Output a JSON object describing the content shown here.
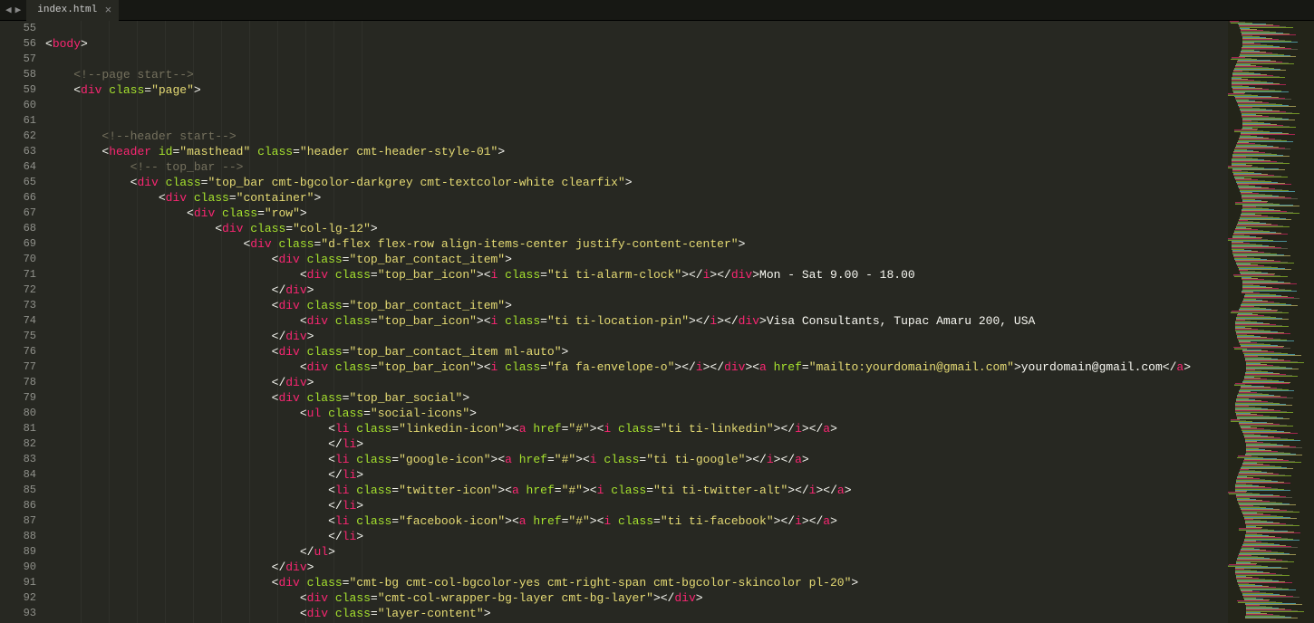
{
  "tab": {
    "title": "index.html",
    "close": "×"
  },
  "nav": {
    "back": "◀",
    "forward": "▶"
  },
  "gutter": [
    "55",
    "56",
    "57",
    "58",
    "59",
    "60",
    "61",
    "62",
    "63",
    "64",
    "65",
    "66",
    "67",
    "68",
    "69",
    "70",
    "71",
    "72",
    "73",
    "74",
    "75",
    "76",
    "77",
    "78",
    "79",
    "80",
    "81",
    "82",
    "83",
    "84",
    "85",
    "86",
    "87",
    "88",
    "89",
    "90",
    "91",
    "92",
    "93"
  ],
  "code": {
    "l55": "",
    "l56_open": "<",
    "l56_tag": "body",
    "l56_close": ">",
    "l57": "",
    "l58_cmt": "<!--page start-->",
    "l59_p1": "<",
    "l59_tag": "div",
    "l59_a1": " class",
    "l59_eq": "=",
    "l59_v1": "\"page\"",
    "l59_p2": ">",
    "l60": "",
    "l61": "",
    "l62_cmt": "<!--header start-->",
    "l63_p1": "<",
    "l63_tag": "header",
    "l63_a1": " id",
    "l63_eq1": "=",
    "l63_v1": "\"masthead\"",
    "l63_a2": " class",
    "l63_eq2": "=",
    "l63_v2": "\"header cmt-header-style-01\"",
    "l63_p2": ">",
    "l64_cmt": "<!-- top_bar -->",
    "l65_p1": "<",
    "l65_tag": "div",
    "l65_a1": " class",
    "l65_eq": "=",
    "l65_v1": "\"top_bar cmt-bgcolor-darkgrey cmt-textcolor-white clearfix\"",
    "l65_p2": ">",
    "l66_p1": "<",
    "l66_tag": "div",
    "l66_a1": " class",
    "l66_eq": "=",
    "l66_v1": "\"container\"",
    "l66_p2": ">",
    "l67_p1": "<",
    "l67_tag": "div",
    "l67_a1": " class",
    "l67_eq": "=",
    "l67_v1": "\"row\"",
    "l67_p2": ">",
    "l68_p1": "<",
    "l68_tag": "div",
    "l68_a1": " class",
    "l68_eq": "=",
    "l68_v1": "\"col-lg-12\"",
    "l68_p2": ">",
    "l69_p1": "<",
    "l69_tag": "div",
    "l69_a1": " class",
    "l69_eq": "=",
    "l69_v1": "\"d-flex flex-row align-items-center justify-content-center\"",
    "l69_p2": ">",
    "l70_p1": "<",
    "l70_tag": "div",
    "l70_a1": " class",
    "l70_eq": "=",
    "l70_v1": "\"top_bar_contact_item\"",
    "l70_p2": ">",
    "l71_p1": "<",
    "l71_tag1": "div",
    "l71_a1": " class",
    "l71_eq1": "=",
    "l71_v1": "\"top_bar_icon\"",
    "l71_p2": "><",
    "l71_tag2": "i",
    "l71_a2": " class",
    "l71_eq2": "=",
    "l71_v2": "\"ti ti-alarm-clock\"",
    "l71_p3": "></",
    "l71_tag3": "i",
    "l71_p4": "></",
    "l71_tag4": "div",
    "l71_p5": ">",
    "l71_txt": "Mon - Sat 9.00 - 18.00",
    "l72_p1": "</",
    "l72_tag": "div",
    "l72_p2": ">",
    "l73_p1": "<",
    "l73_tag": "div",
    "l73_a1": " class",
    "l73_eq": "=",
    "l73_v1": "\"top_bar_contact_item\"",
    "l73_p2": ">",
    "l74_p1": "<",
    "l74_tag1": "div",
    "l74_a1": " class",
    "l74_eq1": "=",
    "l74_v1": "\"top_bar_icon\"",
    "l74_p2": "><",
    "l74_tag2": "i",
    "l74_a2": " class",
    "l74_eq2": "=",
    "l74_v2": "\"ti ti-location-pin\"",
    "l74_p3": "></",
    "l74_tag3": "i",
    "l74_p4": "></",
    "l74_tag4": "div",
    "l74_p5": ">",
    "l74_txt": "Visa Consultants, Tupac Amaru 200, USA",
    "l75_p1": "</",
    "l75_tag": "div",
    "l75_p2": ">",
    "l76_p1": "<",
    "l76_tag": "div",
    "l76_a1": " class",
    "l76_eq": "=",
    "l76_v1": "\"top_bar_contact_item ml-auto\"",
    "l76_p2": ">",
    "l77_p1": "<",
    "l77_tag1": "div",
    "l77_a1": " class",
    "l77_eq1": "=",
    "l77_v1": "\"top_bar_icon\"",
    "l77_p2": "><",
    "l77_tag2": "i",
    "l77_a2": " class",
    "l77_eq2": "=",
    "l77_v2": "\"fa fa-envelope-o\"",
    "l77_p3": "></",
    "l77_tag3": "i",
    "l77_p4": "></",
    "l77_tag4": "div",
    "l77_p5": "><",
    "l77_tag5": "a",
    "l77_a3": " href",
    "l77_eq3": "=",
    "l77_v3": "\"mailto:yourdomain@gmail.com\"",
    "l77_p6": ">",
    "l77_txt": "yourdomain@gmail.com",
    "l77_p7": "</",
    "l77_tag6": "a",
    "l77_p8": ">",
    "l78_p1": "</",
    "l78_tag": "div",
    "l78_p2": ">",
    "l79_p1": "<",
    "l79_tag": "div",
    "l79_a1": " class",
    "l79_eq": "=",
    "l79_v1": "\"top_bar_social\"",
    "l79_p2": ">",
    "l80_p1": "<",
    "l80_tag": "ul",
    "l80_a1": " class",
    "l80_eq": "=",
    "l80_v1": "\"social-icons\"",
    "l80_p2": ">",
    "l81_p1": "<",
    "l81_tag1": "li",
    "l81_a1": " class",
    "l81_eq1": "=",
    "l81_v1": "\"linkedin-icon\"",
    "l81_p2": "><",
    "l81_tag2": "a",
    "l81_a2": " href",
    "l81_eq2": "=",
    "l81_v2": "\"#\"",
    "l81_p3": "><",
    "l81_tag3": "i",
    "l81_a3": " class",
    "l81_eq3": "=",
    "l81_v3": "\"ti ti-linkedin\"",
    "l81_p4": "></",
    "l81_tag4": "i",
    "l81_p5": "></",
    "l81_tag5": "a",
    "l81_p6": ">",
    "l82_p1": "</",
    "l82_tag": "li",
    "l82_p2": ">",
    "l83_p1": "<",
    "l83_tag1": "li",
    "l83_a1": " class",
    "l83_eq1": "=",
    "l83_v1": "\"google-icon\"",
    "l83_p2": "><",
    "l83_tag2": "a",
    "l83_a2": " href",
    "l83_eq2": "=",
    "l83_v2": "\"#\"",
    "l83_p3": "><",
    "l83_tag3": "i",
    "l83_a3": " class",
    "l83_eq3": "=",
    "l83_v3": "\"ti ti-google\"",
    "l83_p4": "></",
    "l83_tag4": "i",
    "l83_p5": "></",
    "l83_tag5": "a",
    "l83_p6": ">",
    "l84_p1": "</",
    "l84_tag": "li",
    "l84_p2": ">",
    "l85_p1": "<",
    "l85_tag1": "li",
    "l85_a1": " class",
    "l85_eq1": "=",
    "l85_v1": "\"twitter-icon\"",
    "l85_p2": "><",
    "l85_tag2": "a",
    "l85_a2": " href",
    "l85_eq2": "=",
    "l85_v2": "\"#\"",
    "l85_p3": "><",
    "l85_tag3": "i",
    "l85_a3": " class",
    "l85_eq3": "=",
    "l85_v3": "\"ti ti-twitter-alt\"",
    "l85_p4": "></",
    "l85_tag4": "i",
    "l85_p5": "></",
    "l85_tag5": "a",
    "l85_p6": ">",
    "l86_p1": "</",
    "l86_tag": "li",
    "l86_p2": ">",
    "l87_p1": "<",
    "l87_tag1": "li",
    "l87_a1": " class",
    "l87_eq1": "=",
    "l87_v1": "\"facebook-icon\"",
    "l87_p2": "><",
    "l87_tag2": "a",
    "l87_a2": " href",
    "l87_eq2": "=",
    "l87_v2": "\"#\"",
    "l87_p3": "><",
    "l87_tag3": "i",
    "l87_a3": " class",
    "l87_eq3": "=",
    "l87_v3": "\"ti ti-facebook\"",
    "l87_p4": "></",
    "l87_tag4": "i",
    "l87_p5": "></",
    "l87_tag5": "a",
    "l87_p6": ">",
    "l88_p1": "</",
    "l88_tag": "li",
    "l88_p2": ">",
    "l89_p1": "</",
    "l89_tag": "ul",
    "l89_p2": ">",
    "l90_p1": "</",
    "l90_tag": "div",
    "l90_p2": ">",
    "l91_p1": "<",
    "l91_tag": "div",
    "l91_a1": " class",
    "l91_eq": "=",
    "l91_v1": "\"cmt-bg cmt-col-bgcolor-yes cmt-right-span cmt-bgcolor-skincolor pl-20\"",
    "l91_p2": ">",
    "l92_p1": "<",
    "l92_tag": "div",
    "l92_a1": " class",
    "l92_eq": "=",
    "l92_v1": "\"cmt-col-wrapper-bg-layer cmt-bg-layer\"",
    "l92_p2": "></",
    "l92_tag2": "div",
    "l92_p3": ">",
    "l93_p1": "<",
    "l93_tag": "div",
    "l93_a1": " class",
    "l93_eq": "=",
    "l93_v1": "\"layer-content\"",
    "l93_p2": ">"
  },
  "indent": {
    "l56": 0,
    "l58": 1,
    "l59": 1,
    "l62": 2,
    "l63": 2,
    "l64": 3,
    "l65": 3,
    "l66": 4,
    "l67": 5,
    "l68": 6,
    "l69": 7,
    "l70": 8,
    "l71": 9,
    "l72": 8,
    "l73": 8,
    "l74": 9,
    "l75": 8,
    "l76": 8,
    "l77": 9,
    "l78": 8,
    "l79": 8,
    "l80": 9,
    "l81": 10,
    "l82": 10,
    "l83": 10,
    "l84": 10,
    "l85": 10,
    "l86": 10,
    "l87": 10,
    "l88": 10,
    "l89": 9,
    "l90": 8,
    "l91": 8,
    "l92": 9,
    "l93": 9
  }
}
